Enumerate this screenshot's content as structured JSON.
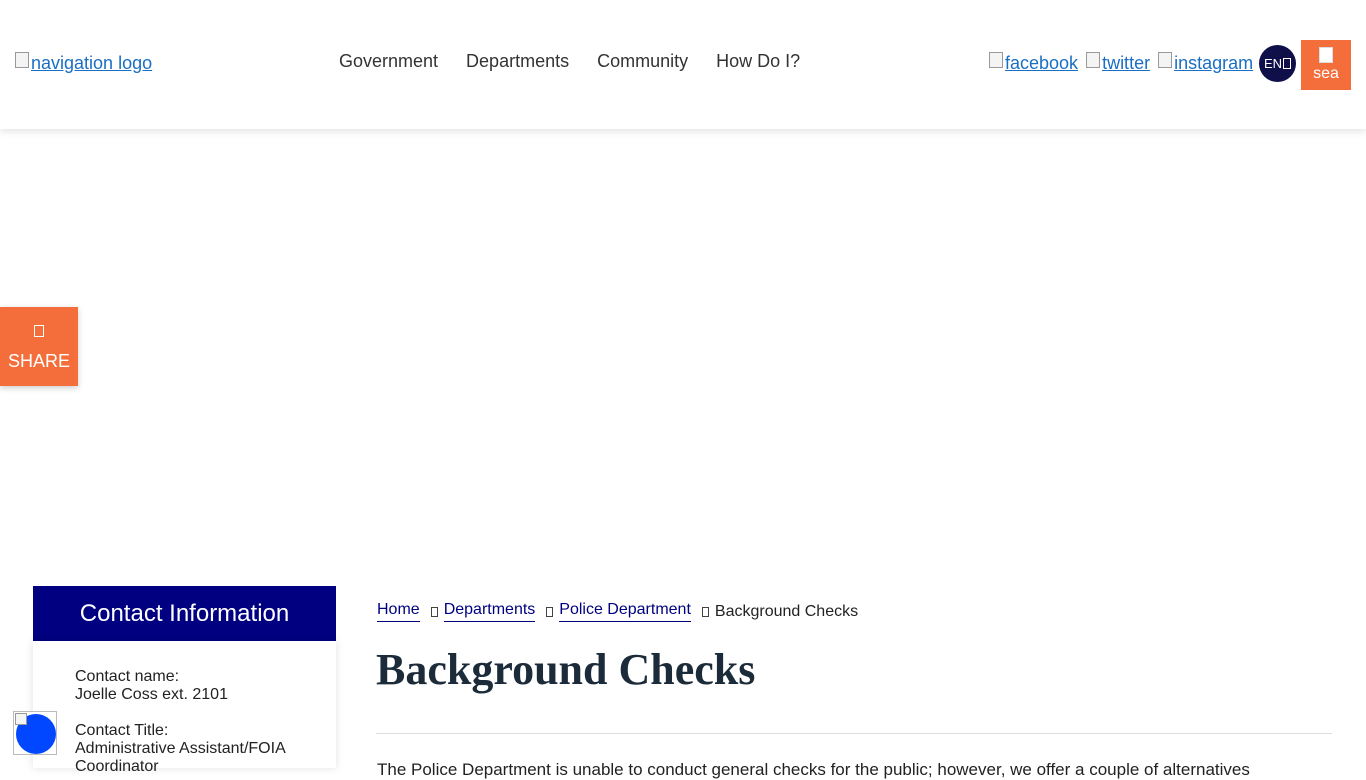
{
  "header": {
    "logo_alt": "navigation logo",
    "nav": [
      "Government",
      "Departments",
      "Community",
      "How Do I?"
    ],
    "social": [
      "facebook",
      "twitter",
      "instagram"
    ],
    "lang_label": "EN",
    "search_alt": "sea"
  },
  "share": {
    "label": "SHARE",
    "icon": "share-icon"
  },
  "sidebar": {
    "title": "Contact Information",
    "name_label": "Contact name:",
    "name_value": "Joelle Coss ext. 2101",
    "title_label": "Contact Title:",
    "title_value": "Administrative Assistant/FOIA Coordinator"
  },
  "breadcrumb": {
    "home": "Home",
    "departments": "Departments",
    "police": "Police Department",
    "current": "Background Checks"
  },
  "page": {
    "title": "Background Checks",
    "intro": "The Police Department is unable to conduct general checks for the public; however, we offer a couple of alternatives"
  },
  "colors": {
    "accent": "#f36e3b",
    "navy": "#000080",
    "dark": "#0f0f4a",
    "a11y": "#0047ff"
  }
}
